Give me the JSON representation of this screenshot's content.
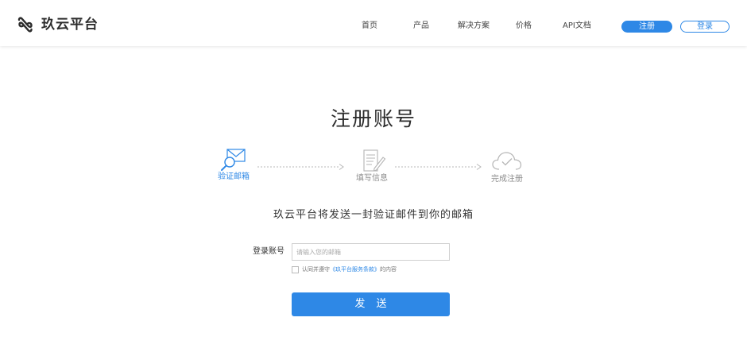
{
  "header": {
    "brand": "玖云平台",
    "nav": [
      {
        "label": "首页"
      },
      {
        "label": "产品"
      },
      {
        "label": "解决方案"
      },
      {
        "label": "价格"
      },
      {
        "label": "API文档"
      }
    ],
    "register_label": "注册",
    "login_label": "登录"
  },
  "main": {
    "title": "注册账号",
    "steps": [
      {
        "label": "验证邮箱",
        "icon": "email-search-icon",
        "state": "active"
      },
      {
        "label": "填写信息",
        "icon": "document-edit-icon",
        "state": "inactive"
      },
      {
        "label": "完成注册",
        "icon": "cloud-check-icon",
        "state": "inactive"
      }
    ],
    "subtitle": "玖云平台将发送一封验证邮件到你的邮箱",
    "form": {
      "account_label": "登录账号",
      "email_placeholder": "请输入您的邮箱",
      "agree_prefix": "认同并遵守",
      "terms_link": "《玖平台服务条款》",
      "agree_suffix": "的内容",
      "send_label": "发送"
    }
  },
  "colors": {
    "accent": "#2e88e6",
    "inactive": "#8c8c8c"
  }
}
